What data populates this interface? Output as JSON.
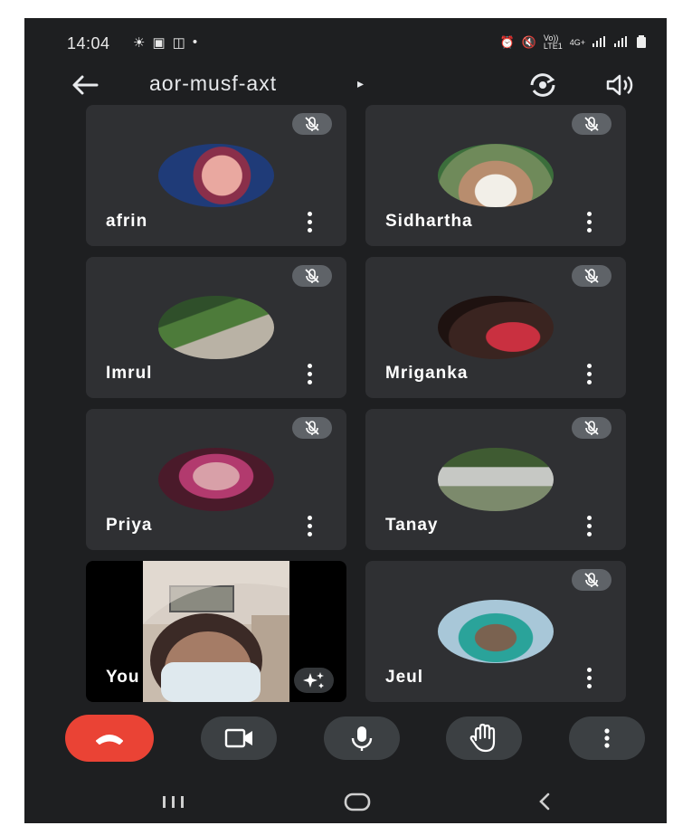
{
  "status_bar": {
    "time": "14:04",
    "left_icons": [
      "weather-icon",
      "gallery-icon",
      "screen-icon",
      "dot-icon"
    ],
    "right_icons": [
      "alarm-icon",
      "mute-icon",
      "volte-icon",
      "signal-icon",
      "signal-icon",
      "battery-icon"
    ],
    "volte_top": "Vo))",
    "volte_bottom": "LTE1",
    "network": "4G+"
  },
  "header": {
    "meeting_code": "aor-musf-axt",
    "caret": "▸"
  },
  "participants": [
    {
      "name": "afrin",
      "muted": true,
      "colors": [
        "#1f3b78",
        "#e9a8a0",
        "#8a2f4a"
      ]
    },
    {
      "name": "Sidhartha",
      "muted": true,
      "colors": [
        "#f2efe8",
        "#b88d6e",
        "#3b6e3b"
      ]
    },
    {
      "name": "Imrul",
      "muted": true,
      "colors": [
        "#4d7b3a",
        "#b9b2a5",
        "#2f4f2a"
      ]
    },
    {
      "name": "Mriganka",
      "muted": true,
      "colors": [
        "#3a2420",
        "#c93040",
        "#1e1210"
      ]
    },
    {
      "name": "Priya",
      "muted": true,
      "colors": [
        "#4a1a2a",
        "#d8a0a8",
        "#b23a6e"
      ]
    },
    {
      "name": "Tanay",
      "muted": true,
      "colors": [
        "#c6c8c4",
        "#3f5b32",
        "#7c8a6c"
      ]
    },
    {
      "name": "You",
      "muted": false,
      "self": true
    },
    {
      "name": "Jeul",
      "muted": true,
      "colors": [
        "#a8c7d8",
        "#2aa39a",
        "#7a6250"
      ]
    }
  ],
  "controls": [
    "end-call",
    "camera",
    "microphone",
    "raise-hand",
    "more-options"
  ],
  "colors": {
    "background": "#1e1f21",
    "tile": "#2f3033",
    "end_call": "#ea4335",
    "control": "#3c4043"
  }
}
